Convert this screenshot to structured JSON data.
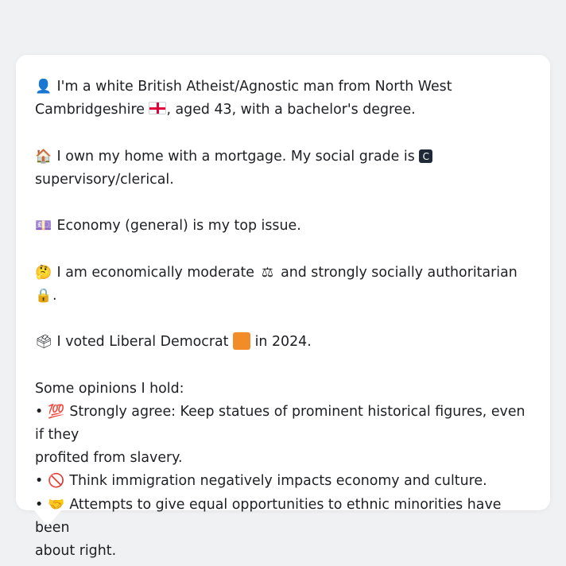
{
  "profile": {
    "p1": {
      "icon": "bust-in-silhouette",
      "text_a": "I'm a white British Atheist/Agnostic man from North West",
      "text_b": "Cambridgeshire",
      "flag_icon": "england-flag",
      "text_c": ", aged 43, with a bachelor's degree."
    },
    "p2": {
      "icon": "house",
      "text_a": "I own my home with a mortgage. My social grade is",
      "grade_badge": "C",
      "text_b": "supervisory/clerical."
    },
    "p3": {
      "icon": "money-bill",
      "text": "Economy (general) is my top issue."
    },
    "p4": {
      "icon": "thinking-face",
      "text_a": "I am economically moderate",
      "scales_icon": "balance-scale",
      "text_b": "and strongly socially authoritarian",
      "lock_icon": "lock",
      "text_c": "."
    },
    "p5": {
      "icon": "ballot-box",
      "text_a": "I voted Liberal Democrat",
      "party_color": "#f28c28",
      "text_b": "in 2024."
    },
    "opinions": {
      "heading": "Some opinions I hold:",
      "items": [
        {
          "bullet": "•",
          "icon": "hundred-points",
          "line1": "Strongly agree: Keep statues of prominent historical figures, even if they",
          "line2": "profited from slavery."
        },
        {
          "bullet": "•",
          "icon": "prohibited",
          "line1": "Think immigration negatively impacts economy and culture.",
          "line2": ""
        },
        {
          "bullet": "•",
          "icon": "handshake",
          "line1": "Attempts to give equal opportunities to ethnic minorities have been",
          "line2": "about right."
        }
      ]
    }
  }
}
